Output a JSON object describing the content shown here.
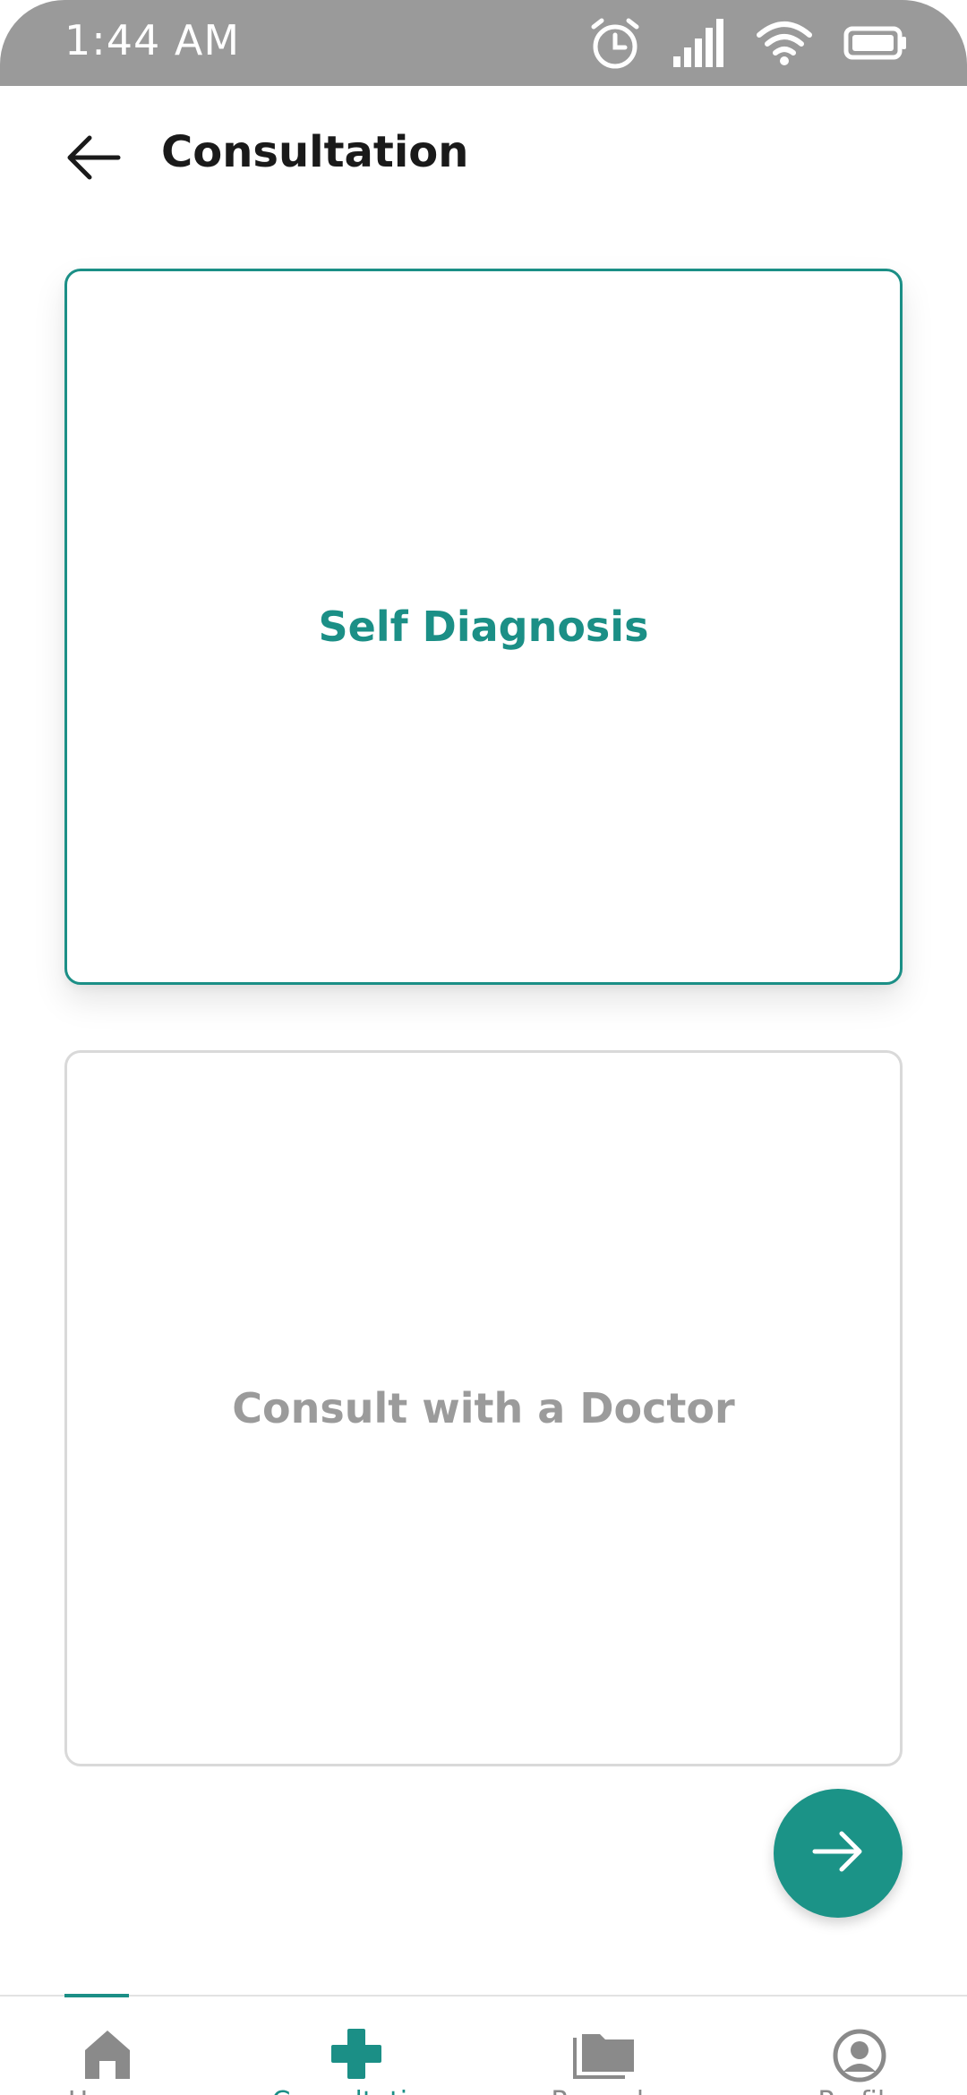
{
  "status_bar": {
    "time": "1:44 AM",
    "icons": [
      "alarm-icon",
      "signal-icon",
      "wifi-icon",
      "battery-icon"
    ]
  },
  "header": {
    "title": "Consultation",
    "back_icon": "arrow-left-icon"
  },
  "options": [
    {
      "label": "Self Diagnosis",
      "selected": true
    },
    {
      "label": "Consult with a Doctor",
      "selected": false
    }
  ],
  "fab": {
    "icon": "arrow-right-icon"
  },
  "bottom_nav": {
    "items": [
      {
        "label": "Home",
        "icon": "home-icon",
        "active": false
      },
      {
        "label": "Consultation",
        "icon": "medical-cross-icon",
        "active": true
      },
      {
        "label": "Records",
        "icon": "folder-icon",
        "active": false
      },
      {
        "label": "Profile",
        "icon": "profile-icon",
        "active": false
      }
    ]
  },
  "colors": {
    "accent": "#1b8f86",
    "status_bar": "#9a9a9a",
    "muted_text": "#9b9b9b",
    "card_border_inactive": "#d9d9d9"
  }
}
